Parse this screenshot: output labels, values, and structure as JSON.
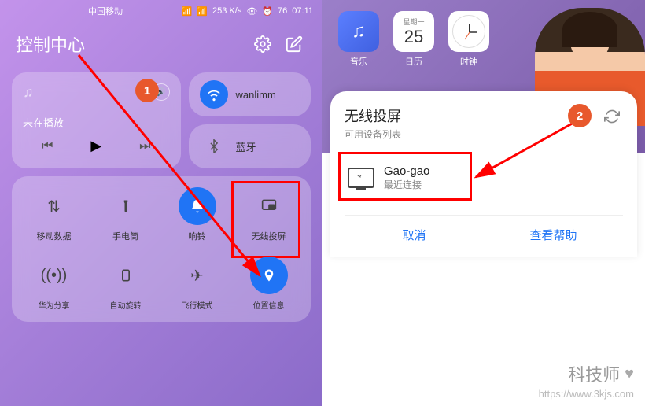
{
  "status": {
    "carrier": "中国移动",
    "speed": "253 K/s",
    "battery": "76",
    "time": "07:11"
  },
  "header": {
    "title": "控制中心"
  },
  "media": {
    "status": "未在播放"
  },
  "toggles": {
    "wifi": {
      "label": "wanlimm"
    },
    "bt": {
      "label": "蓝牙"
    }
  },
  "tiles": [
    {
      "label": "移动数据",
      "icon": "⇅"
    },
    {
      "label": "手电筒",
      "icon": "🔦"
    },
    {
      "label": "响铃",
      "icon": "🔔",
      "active": true
    },
    {
      "label": "无线投屏",
      "icon": "⎚"
    },
    {
      "label": "华为分享",
      "icon": "((•))"
    },
    {
      "label": "自动旋转",
      "icon": "▢"
    },
    {
      "label": "飞行模式",
      "icon": "✈"
    },
    {
      "label": "位置信息",
      "icon": "📍",
      "active": true
    }
  ],
  "badges": {
    "one": "1",
    "two": "2"
  },
  "apps": [
    {
      "label": "音乐",
      "icon": "🎵",
      "weekday": ""
    },
    {
      "label": "日历",
      "weekday": "星期一",
      "date": "25"
    },
    {
      "label": "时钟"
    }
  ],
  "cast": {
    "title": "无线投屏",
    "subtitle": "可用设备列表",
    "device": {
      "name": "Gao-gao",
      "status": "最近连接"
    },
    "cancel": "取消",
    "help": "查看帮助"
  },
  "watermark": {
    "brand": "科技师",
    "url": "https://www.3kjs.com"
  }
}
